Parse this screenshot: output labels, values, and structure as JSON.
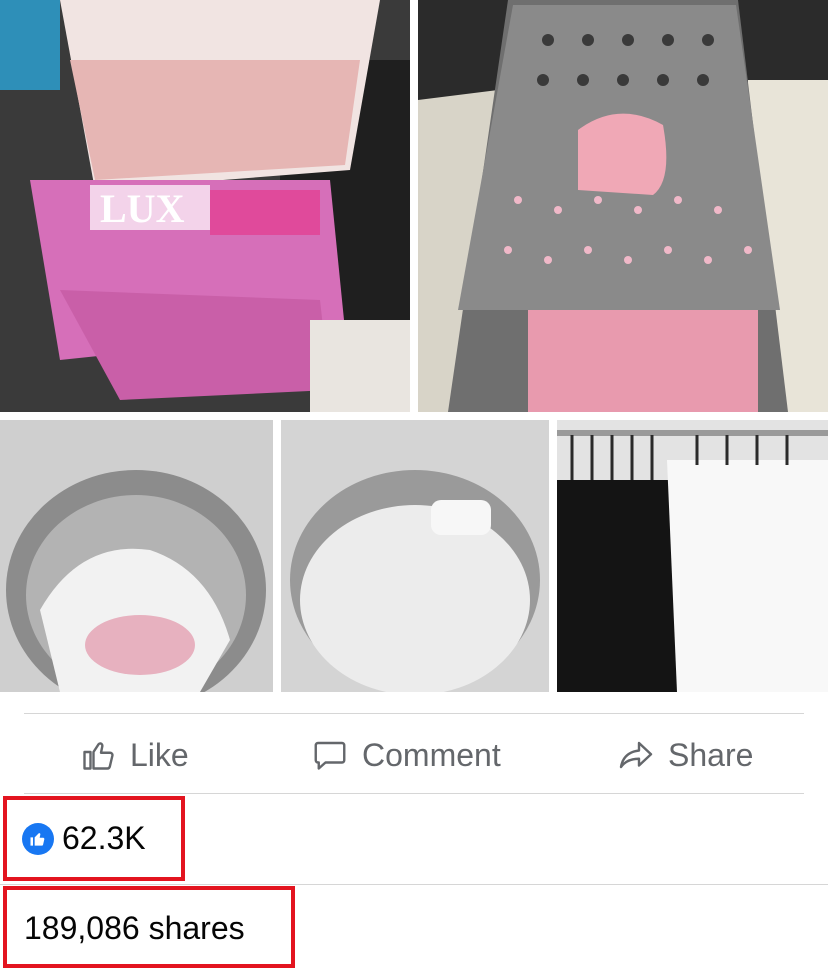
{
  "post": {
    "photos": [
      {
        "subject": "lux-soap-bars-icon"
      },
      {
        "subject": "grater-icon"
      },
      {
        "subject": "washing-machine-clothes-icon"
      },
      {
        "subject": "washing-machine-foam-icon"
      },
      {
        "subject": "hanging-shirts-icon"
      }
    ]
  },
  "actions": {
    "like_label": "Like",
    "comment_label": "Comment",
    "share_label": "Share"
  },
  "reactions": {
    "count": "62.3K"
  },
  "shares": {
    "text": "189,086 shares"
  },
  "colors": {
    "action_gray": "#64676b",
    "like_blue": "#1877f2",
    "highlight_red": "#e3141f",
    "divider": "#d6d6d6"
  }
}
